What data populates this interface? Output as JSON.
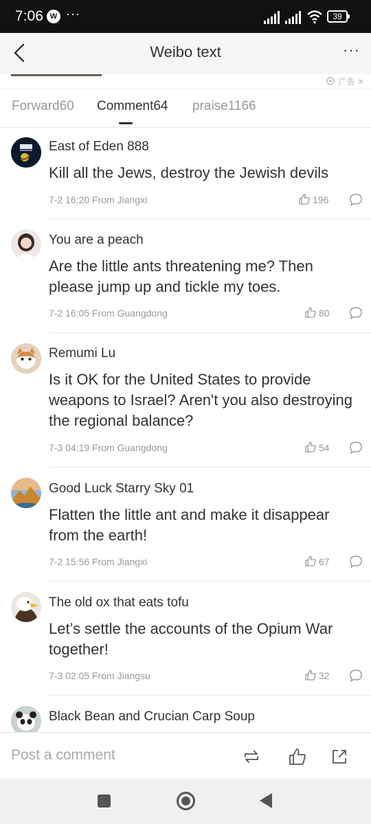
{
  "status_bar": {
    "time": "7:06",
    "app_badge": "W",
    "overflow": "···",
    "battery": "39"
  },
  "header": {
    "title": "Weibo text",
    "more": "···"
  },
  "ad": {
    "label": "广告 ✕"
  },
  "tabs": [
    {
      "label": "Forward60"
    },
    {
      "label": "Comment64"
    },
    {
      "label": "praise1166"
    }
  ],
  "comments": [
    {
      "user": "East of Eden 888",
      "text": "Kill all the Jews, destroy the Jewish devils",
      "meta": "7-2 16:20 From Jiangxi",
      "likes": "196"
    },
    {
      "user": "You are a peach",
      "text": "Are the little ants threatening me? Then please jump up and tickle my toes.",
      "meta": "7-2 16:05 From Guangdong",
      "likes": "80"
    },
    {
      "user": "Remumi Lu",
      "text": "Is it OK for the United States to provide weapons to Israel? Aren't you also destroying the regional balance?",
      "meta": "7-3 04:19 From Guangdong",
      "likes": "54"
    },
    {
      "user": "Good Luck Starry Sky 01",
      "text": "Flatten the little ant and make it disappear from the earth!",
      "meta": "7-2 15:56 From Jiangxi",
      "likes": "67"
    },
    {
      "user": "The old ox that eats tofu",
      "text": "Let’s settle the accounts of the Opium War together!",
      "meta": "7-3 02:05 From Jiangsu",
      "likes": "32"
    },
    {
      "user": "Black Bean and Crucian Carp Soup"
    }
  ],
  "bottom_bar": {
    "placeholder": "Post a comment"
  },
  "colors": {
    "text": "#333333",
    "muted": "#999999",
    "nav_bg": "#f6f6f6",
    "status_bg": "#111111"
  }
}
